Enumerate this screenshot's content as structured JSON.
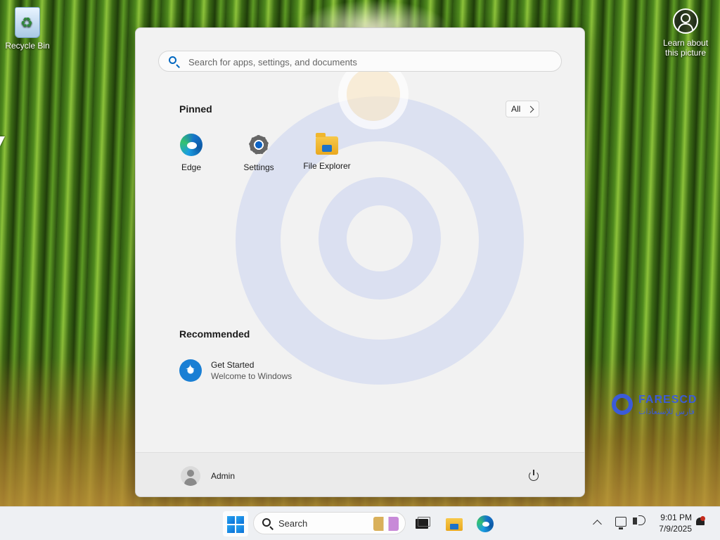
{
  "desktop": {
    "icons": [
      {
        "label": "Recycle Bin",
        "icon": "recycle-bin-icon"
      },
      {
        "label": "Learn about this picture",
        "icon": "camera-info-icon"
      }
    ],
    "watermark": {
      "title": "FARESCD",
      "subtitle": "فارس للإستعادات"
    }
  },
  "start_menu": {
    "search_placeholder": "Search for apps, settings, and documents",
    "pinned_title": "Pinned",
    "all_button_label": "All",
    "pinned": [
      {
        "label": "Edge",
        "icon": "edge-icon"
      },
      {
        "label": "Settings",
        "icon": "settings-gear-icon"
      },
      {
        "label": "File Explorer",
        "icon": "folder-icon"
      }
    ],
    "recommended_title": "Recommended",
    "recommended": [
      {
        "title": "Get Started",
        "subtitle": "Welcome to Windows",
        "icon": "get-started-icon"
      }
    ],
    "user_name": "Admin"
  },
  "taskbar": {
    "search_label": "Search",
    "time": "9:01 PM",
    "date": "7/9/2025"
  },
  "colors": {
    "accent": "#0067c0",
    "menu_bg": "#f2f2f2",
    "taskbar_bg": "#eef0f3",
    "watermark_blue": "#3b5bd8"
  }
}
